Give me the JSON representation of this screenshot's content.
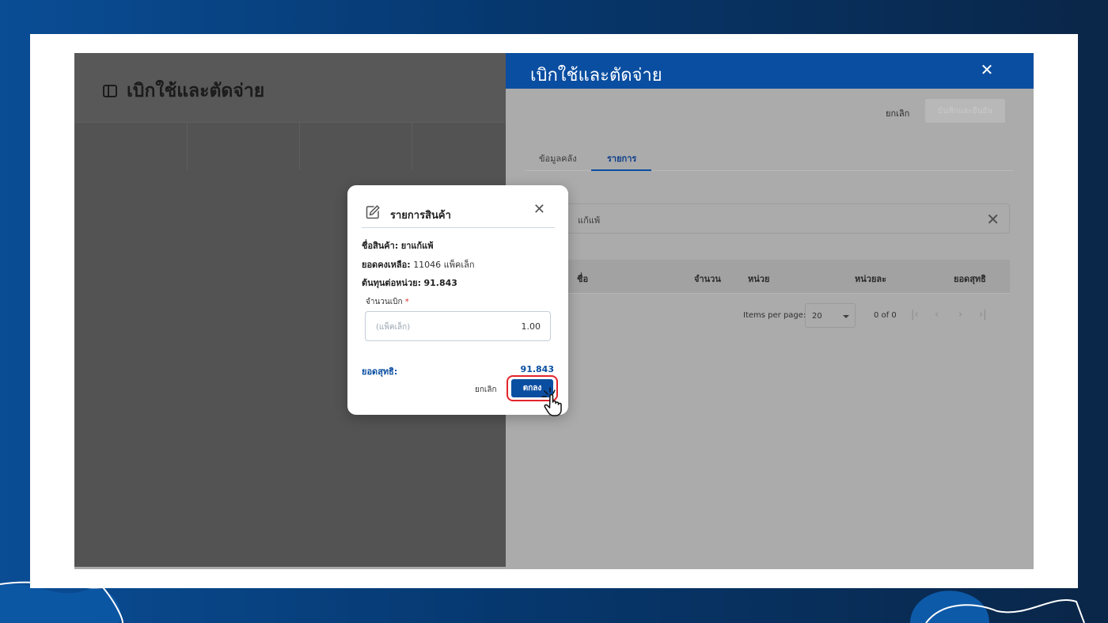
{
  "page": {
    "title": "เบิกใช้และตัดจ่าย"
  },
  "drawer": {
    "title": "เบิกใช้และตัดจ่าย",
    "cancel_label": "ยกเลิก",
    "save_label": "บันทึกและยืนยัน",
    "tabs": [
      {
        "label": "ข้อมูลคลัง",
        "active": false
      },
      {
        "label": "รายการ",
        "active": true
      }
    ],
    "search_value": "แก้แพ้",
    "table_headers": [
      "ชื่อ",
      "จำนวน",
      "หน่วย",
      "หน่วยละ",
      "ยอดสุทธิ"
    ],
    "pager": {
      "items_per_page_label": "Items per page:",
      "items_per_page_value": "20",
      "range_label": "0 of 0"
    }
  },
  "modal": {
    "title": "รายการสินค้า",
    "product_name_label": "ชื่อสินค้า:",
    "product_name_value": "ยาแก้แพ้",
    "remaining_label": "ยอดคงเหลือ:",
    "remaining_value": "11046 แพ็คเล็ก",
    "unit_cost_label": "ต้นทุนต่อหน่วย:",
    "unit_cost_value": "91.843",
    "quantity_label": "จำนวนเบิก",
    "quantity_required_mark": "*",
    "quantity_unit": "(แพ็คเล็ก)",
    "quantity_value": "1.00",
    "total_label": "ยอดสุทธิ:",
    "total_value": "91.843",
    "cancel_label": "ยกเลิก",
    "ok_label": "ตกลง"
  },
  "colors": {
    "primary": "#0a4ea1",
    "highlight_ring": "#e3242b",
    "background_gradient_start": "#0a4d95",
    "background_gradient_end": "#0a2648"
  },
  "icons": {
    "sidebar_toggle": "sidebar-icon",
    "close": "close-icon",
    "edit": "edit-icon",
    "pointer": "hand-pointer-icon"
  }
}
